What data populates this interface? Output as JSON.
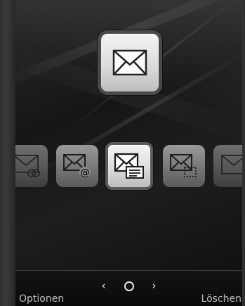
{
  "softkeys": {
    "left_label": "Optionen",
    "right_label": "Löschen"
  },
  "nav": {
    "prev_symbol": "‹",
    "next_symbol": "›"
  },
  "icons": {
    "featured": "envelope-icon",
    "carousel": [
      "envelope-link-icon",
      "envelope-email-icon",
      "envelope-message-icon",
      "envelope-template-icon",
      "envelope-icon"
    ]
  }
}
